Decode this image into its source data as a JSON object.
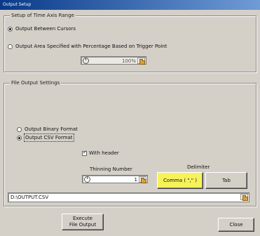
{
  "window": {
    "title": "Output Setup"
  },
  "time_axis": {
    "group_label": "Setup of Time Axis Range",
    "option_cursors": "Output Between Cursors",
    "option_trigger": "Output Area Specified with Percentage Based on Trigger Point",
    "percentage_value": "100%"
  },
  "file_output": {
    "group_label": "File Output Settings",
    "option_binary": "Output Binary Format",
    "option_csv": "Output CSV Format",
    "with_header_label": "With header",
    "thinning_label": "Thinning Number",
    "thinning_value": "1",
    "delimiter_label": "Delimiter",
    "delimiter_comma": "Comma ( \",\" )",
    "delimiter_tab": "Tab",
    "path_value": "D:\\OUTPUT.CSV"
  },
  "buttons": {
    "execute_line1": "Execute",
    "execute_line2": "File Output",
    "close": "Close"
  }
}
